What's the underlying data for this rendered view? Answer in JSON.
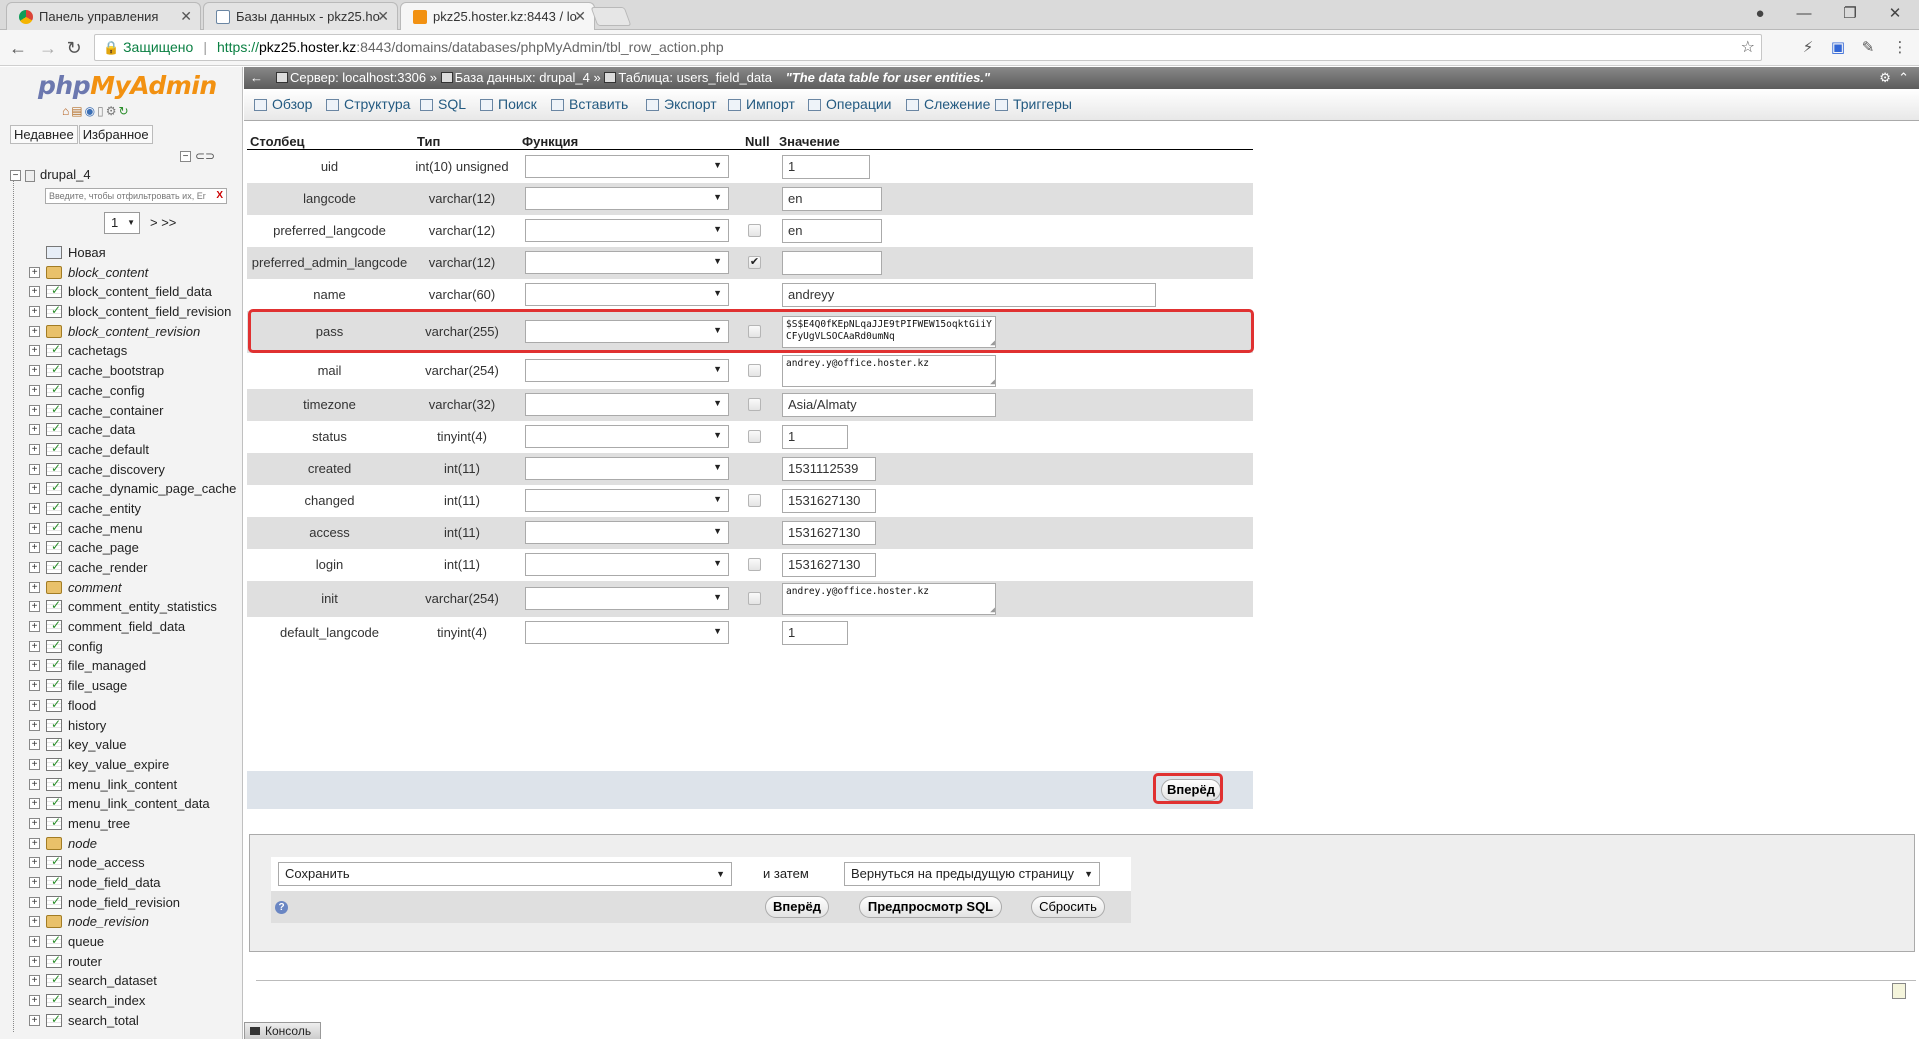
{
  "browser": {
    "tabs": [
      {
        "label": "Панель управления"
      },
      {
        "label": "Базы данных - pkz25.ho"
      },
      {
        "label": "pkz25.hoster.kz:8443 / lo"
      }
    ],
    "secure_label": "Защищено",
    "url_scheme": "https://",
    "url_host": "pkz25.hoster.kz",
    "url_rest": ":8443/domains/databases/phpMyAdmin/tbl_row_action.php"
  },
  "nav": {
    "logo_php": "php",
    "logo_my": "MyAdmin",
    "recent": "Недавнее",
    "favorites": "Избранное",
    "db_name": "drupal_4",
    "filter_placeholder": "Введите, чтобы отфильтровать их, Er",
    "page": "1",
    "page_next": "> >>",
    "tables": [
      {
        "name": "Новая",
        "kind": "new"
      },
      {
        "name": "block_content",
        "kind": "view"
      },
      {
        "name": "block_content_field_data",
        "kind": "table"
      },
      {
        "name": "block_content_field_revision",
        "kind": "table"
      },
      {
        "name": "block_content_revision",
        "kind": "view"
      },
      {
        "name": "cachetags",
        "kind": "table"
      },
      {
        "name": "cache_bootstrap",
        "kind": "table"
      },
      {
        "name": "cache_config",
        "kind": "table"
      },
      {
        "name": "cache_container",
        "kind": "table"
      },
      {
        "name": "cache_data",
        "kind": "table"
      },
      {
        "name": "cache_default",
        "kind": "table"
      },
      {
        "name": "cache_discovery",
        "kind": "table"
      },
      {
        "name": "cache_dynamic_page_cache",
        "kind": "table"
      },
      {
        "name": "cache_entity",
        "kind": "table"
      },
      {
        "name": "cache_menu",
        "kind": "table"
      },
      {
        "name": "cache_page",
        "kind": "table"
      },
      {
        "name": "cache_render",
        "kind": "table"
      },
      {
        "name": "comment",
        "kind": "view"
      },
      {
        "name": "comment_entity_statistics",
        "kind": "table"
      },
      {
        "name": "comment_field_data",
        "kind": "table"
      },
      {
        "name": "config",
        "kind": "table"
      },
      {
        "name": "file_managed",
        "kind": "table"
      },
      {
        "name": "file_usage",
        "kind": "table"
      },
      {
        "name": "flood",
        "kind": "table"
      },
      {
        "name": "history",
        "kind": "table"
      },
      {
        "name": "key_value",
        "kind": "table"
      },
      {
        "name": "key_value_expire",
        "kind": "table"
      },
      {
        "name": "menu_link_content",
        "kind": "table"
      },
      {
        "name": "menu_link_content_data",
        "kind": "table"
      },
      {
        "name": "menu_tree",
        "kind": "table"
      },
      {
        "name": "node",
        "kind": "view"
      },
      {
        "name": "node_access",
        "kind": "table"
      },
      {
        "name": "node_field_data",
        "kind": "table"
      },
      {
        "name": "node_field_revision",
        "kind": "table"
      },
      {
        "name": "node_revision",
        "kind": "view"
      },
      {
        "name": "queue",
        "kind": "table"
      },
      {
        "name": "router",
        "kind": "table"
      },
      {
        "name": "search_dataset",
        "kind": "table"
      },
      {
        "name": "search_index",
        "kind": "table"
      },
      {
        "name": "search_total",
        "kind": "table"
      }
    ]
  },
  "breadcrumb": {
    "server": "Сервер: localhost:3306",
    "sep1": "»",
    "database": "База данных: drupal_4",
    "sep2": "»",
    "table": "Таблица: users_field_data",
    "comment": "\"The data table for user entities.\""
  },
  "menu": {
    "browse": "Обзор",
    "structure": "Структура",
    "sql": "SQL",
    "search": "Поиск",
    "insert": "Вставить",
    "export": "Экспорт",
    "import": "Импорт",
    "operations": "Операции",
    "tracking": "Слежение",
    "triggers": "Триггеры"
  },
  "table": {
    "headers": {
      "column": "Столбец",
      "type": "Тип",
      "function": "Функция",
      "null": "Null",
      "value": "Значение"
    },
    "rows": [
      {
        "col": "uid",
        "type": "int(10) unsigned",
        "null": "none",
        "value": "1",
        "kind": "input"
      },
      {
        "col": "langcode",
        "type": "varchar(12)",
        "null": "none",
        "value": "en",
        "kind": "input"
      },
      {
        "col": "preferred_langcode",
        "type": "varchar(12)",
        "null": "unchecked",
        "value": "en",
        "kind": "input"
      },
      {
        "col": "preferred_admin_langcode",
        "type": "varchar(12)",
        "null": "checked",
        "value": "",
        "kind": "input"
      },
      {
        "col": "name",
        "type": "varchar(60)",
        "null": "none",
        "value": "andreyy",
        "kind": "input"
      },
      {
        "col": "pass",
        "type": "varchar(255)",
        "null": "unchecked",
        "value": "$S$E4Q0fKEpNLqaJJE9tPIFWEW15oqktGiiYCFyUgVLSOCAaRd0umNq",
        "kind": "textarea"
      },
      {
        "col": "mail",
        "type": "varchar(254)",
        "null": "unchecked",
        "value": "andrey.y@office.hoster.kz",
        "kind": "textarea"
      },
      {
        "col": "timezone",
        "type": "varchar(32)",
        "null": "unchecked",
        "value": "Asia/Almaty",
        "kind": "input"
      },
      {
        "col": "status",
        "type": "tinyint(4)",
        "null": "unchecked",
        "value": "1",
        "kind": "input"
      },
      {
        "col": "created",
        "type": "int(11)",
        "null": "none",
        "value": "1531112539",
        "kind": "input"
      },
      {
        "col": "changed",
        "type": "int(11)",
        "null": "unchecked",
        "value": "1531627130",
        "kind": "input"
      },
      {
        "col": "access",
        "type": "int(11)",
        "null": "none",
        "value": "1531627130",
        "kind": "input"
      },
      {
        "col": "login",
        "type": "int(11)",
        "null": "unchecked",
        "value": "1531627130",
        "kind": "input"
      },
      {
        "col": "init",
        "type": "varchar(254)",
        "null": "unchecked",
        "value": "andrey.y@office.hoster.kz",
        "kind": "textarea"
      },
      {
        "col": "default_langcode",
        "type": "tinyint(4)",
        "null": "none",
        "value": "1",
        "kind": "input"
      }
    ],
    "go_label": "Вперёд"
  },
  "save": {
    "action": "Сохранить",
    "and_then": "и затем",
    "after": "Вернуться на предыдущую страницу",
    "go": "Вперёд",
    "preview": "Предпросмотр SQL",
    "reset": "Сбросить"
  },
  "console_label": "Консоль",
  "colors": {
    "highlight": "#e03131",
    "link": "#235a81"
  }
}
